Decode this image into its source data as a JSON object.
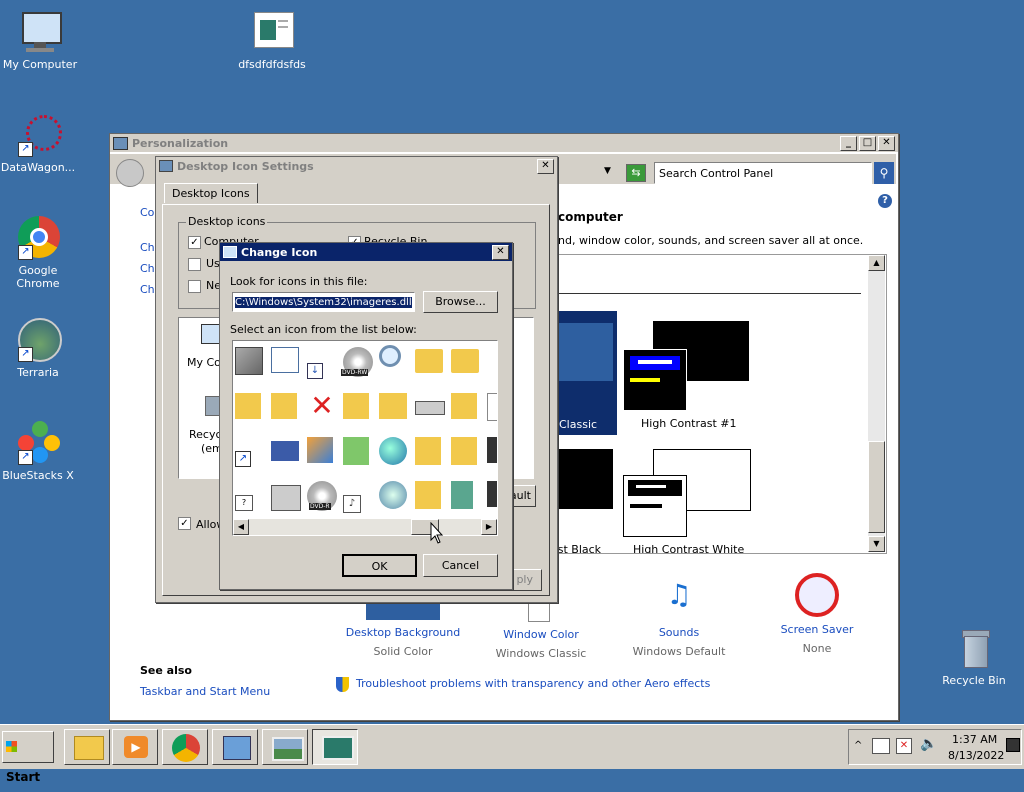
{
  "desktop": {
    "icons": [
      {
        "label": "My Computer"
      },
      {
        "label": "dfsdfdfdsfds"
      },
      {
        "label": "DataWagon..."
      },
      {
        "label": "Google Chrome"
      },
      {
        "label": "Terraria"
      },
      {
        "label": "BlueStacks X"
      },
      {
        "label": "Recycle Bin"
      }
    ]
  },
  "personalization": {
    "title": "Personalization",
    "search_placeholder": "Search Control Panel",
    "heading_fragment": "computer",
    "desc_fragment": "nd, window color, sounds, and screen saver all at once.",
    "left_links": [
      "Co",
      "Cha",
      "Cha",
      "Cha"
    ],
    "themes": [
      {
        "label": "Classic"
      },
      {
        "label": "High Contrast #1"
      },
      {
        "label": "ast Black"
      },
      {
        "label": "High Contrast White"
      }
    ],
    "bottom_items": [
      {
        "label": "Desktop Background",
        "sub": "Solid Color"
      },
      {
        "label": "Window Color",
        "sub": "Windows Classic"
      },
      {
        "label": "Sounds",
        "sub": "Windows Default"
      },
      {
        "label": "Screen Saver",
        "sub": "None"
      }
    ],
    "see_also": "See also",
    "taskbar_link": "Taskbar and Start Menu",
    "troubleshoot_link": "Troubleshoot problems with transparency and other Aero effects"
  },
  "desktop_icon_settings": {
    "title": "Desktop Icon Settings",
    "tab": "Desktop Icons",
    "group": "Desktop icons",
    "chk_computer": "Computer",
    "chk_recycle": "Recycle Bin",
    "chk_us": "Us",
    "chk_ne": "Ne",
    "preview_mycomp": "My Com",
    "preview_recycle": "Recycl",
    "preview_empty": "(emp",
    "default_btn": "ault",
    "allow_chk": "Allow",
    "apply_btn": "ply"
  },
  "change_icon": {
    "title": "Change Icon",
    "look_label": "Look for icons in this file:",
    "file_path": "C:\\Windows\\System32\\imageres.dll",
    "browse": "Browse...",
    "select_label": "Select an icon from the list below:",
    "ok": "OK",
    "cancel": "Cancel",
    "dvd_label": "DVD-RW",
    "dvdr_label": "DVD-R"
  },
  "taskbar": {
    "start": "Start",
    "time": "1:37 AM",
    "date": "8/13/2022"
  },
  "colors": {
    "desktop": "#3a6ea5",
    "title_active": "#0a246a",
    "link": "#1a4dbf"
  }
}
